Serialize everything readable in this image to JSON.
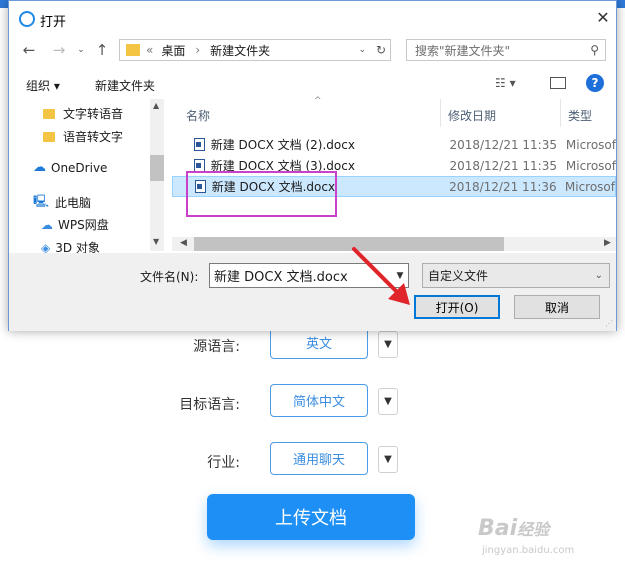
{
  "dialog": {
    "title": "打开",
    "address": {
      "prefix": "«",
      "path": [
        "桌面",
        "新建文件夹"
      ]
    },
    "search_placeholder": "搜索\"新建文件夹\"",
    "commands": {
      "organize": "组织 ▾",
      "new_folder": "新建文件夹"
    },
    "nav_items": [
      {
        "label": "文字转语音",
        "icon": "folder-icon"
      },
      {
        "label": "语音转文字",
        "icon": "folder-icon"
      },
      {
        "label": "OneDrive",
        "icon": "cloud-icon"
      },
      {
        "label": "此电脑",
        "icon": "computer-icon"
      },
      {
        "label": "WPS网盘",
        "icon": "cloud-icon"
      },
      {
        "label": "3D 对象",
        "icon": "3d-objects-icon"
      }
    ],
    "columns": {
      "name": "名称",
      "modified": "修改日期",
      "type": "类型"
    },
    "files": [
      {
        "name": "新建 DOCX 文档 (2).docx",
        "modified": "2018/12/21 11:35",
        "type": "Microsof",
        "selected": false
      },
      {
        "name": "新建 DOCX 文档 (3).docx",
        "modified": "2018/12/21 11:35",
        "type": "Microsof",
        "selected": false
      },
      {
        "name": "新建 DOCX 文档.docx",
        "modified": "2018/12/21 11:36",
        "type": "Microsof",
        "selected": true
      }
    ],
    "filename_label": "文件名(N):",
    "filename_value": "新建 DOCX 文档.docx",
    "filetype": "自定义文件",
    "open_button": "打开(O)",
    "cancel_button": "取消"
  },
  "app": {
    "rows": [
      {
        "label": "源语言:",
        "value": "英文"
      },
      {
        "label": "目标语言:",
        "value": "简体中文"
      },
      {
        "label": "行业:",
        "value": "通用聊天"
      }
    ],
    "upload_button": "上传文档"
  },
  "watermark": {
    "brand": "Bai",
    "brand2": "经验",
    "url": "jingyan.baidu.com"
  },
  "colors": {
    "accent": "#1e8ff5",
    "highlight": "#c940c9",
    "arrow": "#e0242a",
    "selection": "#cce8ff"
  }
}
